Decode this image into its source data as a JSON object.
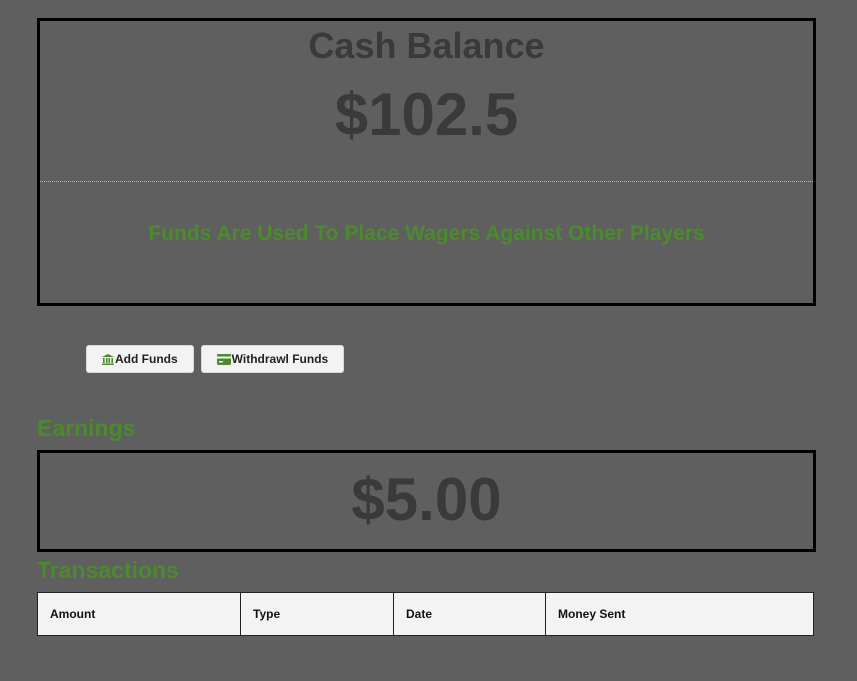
{
  "cash": {
    "title": "Cash Balance",
    "amount": "$102.5",
    "note": "Funds Are Used To Place Wagers Against Other Players"
  },
  "actions": {
    "add_funds_label": "Add Funds",
    "add_funds_icon": "bank-icon",
    "withdraw_label": "Withdrawl Funds",
    "withdraw_icon": "credit-card-icon",
    "icon_color": "#4c8a2e"
  },
  "earnings": {
    "heading": "Earnings",
    "amount": "$5.00"
  },
  "transactions": {
    "heading": "Transactions",
    "columns": [
      "Amount",
      "Type",
      "Date",
      "Money Sent"
    ]
  },
  "colors": {
    "background": "#5f5f5f",
    "accent_green": "#4c8a2e",
    "heading_text": "#3a3a3a"
  }
}
